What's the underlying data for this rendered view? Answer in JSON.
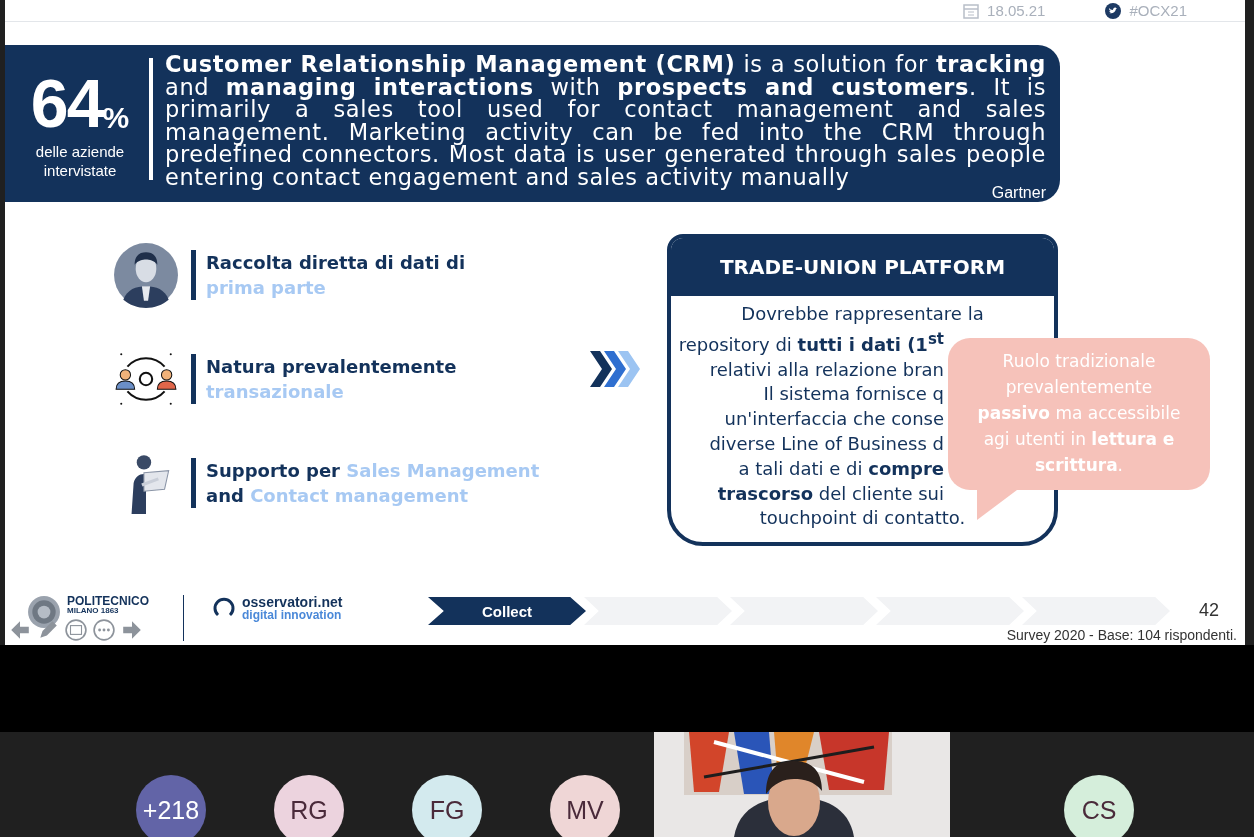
{
  "header": {
    "date": "18.05.21",
    "hashtag": "#OCX21"
  },
  "banner": {
    "stat": "64",
    "unit": "%",
    "stat_caption": "delle aziende intervistate",
    "text": "**Customer Relationship Management (CRM)** is a solution for **tracking** and **managing interactions** with **prospects and customers**. It is primarily a sales tool used for contact management and sales management. Marketing activity can be fed into the CRM through predefined connectors. Most data is user generated through sales people entering contact engagement and sales activity manually",
    "source": "Gartner"
  },
  "points": [
    {
      "kind": "person",
      "lines": [
        {
          "segments": [
            {
              "text": "Raccolta diretta di dati di",
              "highlight": false
            }
          ]
        },
        {
          "segments": [
            {
              "text": "prima parte",
              "highlight": true
            }
          ]
        }
      ]
    },
    {
      "kind": "exchange",
      "lines": [
        {
          "segments": [
            {
              "text": "Natura prevalentemente",
              "highlight": false
            }
          ]
        },
        {
          "segments": [
            {
              "text": "transazionale",
              "highlight": true
            }
          ]
        }
      ]
    },
    {
      "kind": "laptop",
      "lines": [
        {
          "segments": [
            {
              "text": "Supporto per ",
              "highlight": false
            },
            {
              "text": "Sales Management",
              "highlight": true
            }
          ]
        },
        {
          "segments": [
            {
              "text": "and ",
              "highlight": false
            },
            {
              "text": "Contact management",
              "highlight": true
            }
          ]
        }
      ]
    }
  ],
  "platform": {
    "title": "TRADE-UNION PLATFORM",
    "lines": [
      {
        "kind": "full",
        "text": "Dovrebbe rappresentare la"
      },
      {
        "kind": "cut",
        "text": "repository di **tutti i dati (1$^{st}$**"
      },
      {
        "kind": "cut",
        "text": "relativi alla relazione bran"
      },
      {
        "kind": "cut",
        "text": "Il sistema fornisce q"
      },
      {
        "kind": "cut",
        "text": "un'interfaccia che conse"
      },
      {
        "kind": "cut",
        "text": "diverse Line of Business d"
      },
      {
        "kind": "cut",
        "text": "a tali dati e di **compre**"
      },
      {
        "kind": "cut",
        "text": "**trascorso** del cliente sui"
      },
      {
        "kind": "full",
        "text": "touchpoint di contatto."
      }
    ]
  },
  "callout": {
    "text": "Ruolo tradizionale prevalentemente **passivo** ma accessibile agi utenti in **lettura e scrittura**."
  },
  "footer": {
    "institution": "POLITECNICO",
    "institution_sub": "MILANO 1863",
    "brand": "osservatori.net",
    "brand_tagline": "digital innovation",
    "steps": [
      {
        "label": "Collect",
        "selected": true
      },
      {
        "selected": false
      },
      {
        "selected": false
      },
      {
        "selected": false
      },
      {
        "selected": false
      }
    ],
    "page": "42",
    "note": "Survey 2020 - Base: 104 rispondenti."
  },
  "meeting": {
    "participants": [
      {
        "kind": "count",
        "initials": "+218",
        "color": "#6264a7"
      },
      {
        "kind": "avatar",
        "initials": "RG",
        "color": "#ecd3de"
      },
      {
        "kind": "avatar",
        "initials": "FG",
        "color": "#d3eaee"
      },
      {
        "kind": "avatar",
        "initials": "MV",
        "color": "#efd6d6"
      },
      {
        "kind": "video"
      },
      {
        "kind": "avatar",
        "initials": "CS",
        "color": "#d5eedb"
      }
    ]
  }
}
